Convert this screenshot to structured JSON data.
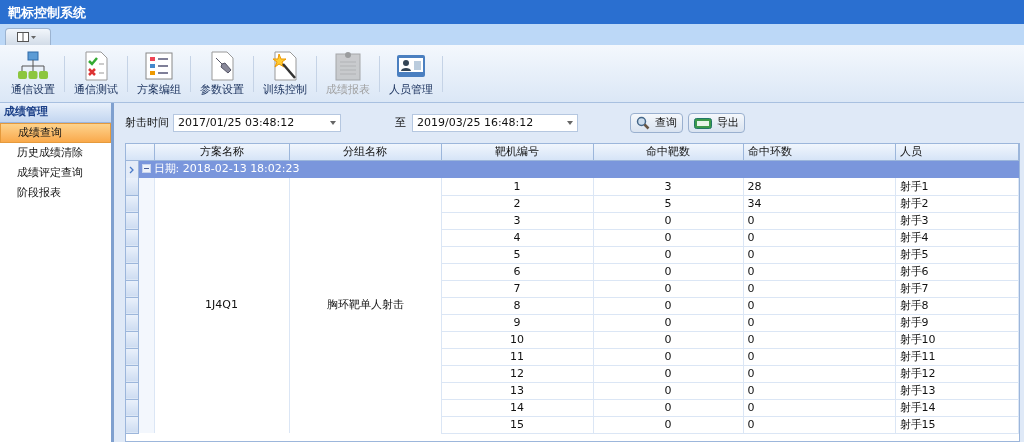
{
  "window": {
    "title": "靶标控制系统"
  },
  "toolbar": [
    {
      "label": "通信设置",
      "disabled": false
    },
    {
      "label": "通信测试",
      "disabled": false
    },
    {
      "label": "方案编组",
      "disabled": false
    },
    {
      "label": "参数设置",
      "disabled": false
    },
    {
      "label": "训练控制",
      "disabled": false
    },
    {
      "label": "成绩报表",
      "disabled": true
    },
    {
      "label": "人员管理",
      "disabled": false
    }
  ],
  "sidebar": {
    "title": "成绩管理",
    "items": [
      {
        "label": "成绩查询",
        "selected": true
      },
      {
        "label": "历史成绩清除",
        "selected": false
      },
      {
        "label": "成绩评定查询",
        "selected": false
      },
      {
        "label": "阶段报表",
        "selected": false
      }
    ]
  },
  "filter": {
    "label": "射击时间",
    "from": "2017/01/25 03:48:12",
    "to_label": "至",
    "to": "2019/03/25 16:48:12",
    "buttons": [
      "查询",
      "导出"
    ]
  },
  "table": {
    "columns": [
      "方案名称",
      "分组名称",
      "靶机编号",
      "命中靶数",
      "命中环数",
      "人员"
    ],
    "group": {
      "label": "日期: 2018-02-13 18:02:23",
      "expanded": true,
      "current": true
    },
    "rows": [
      [
        {
          "text": "1J4Q1",
          "rowspan": 15
        },
        {
          "text": "胸环靶单人射击",
          "rowspan": 15
        },
        "1",
        "3",
        "28",
        "射手1"
      ],
      [
        "2",
        "5",
        "34",
        "射手2"
      ],
      [
        "3",
        "0",
        "0",
        "射手3"
      ],
      [
        "4",
        "0",
        "0",
        "射手4"
      ],
      [
        "5",
        "0",
        "0",
        "射手5"
      ],
      [
        "6",
        "0",
        "0",
        "射手6"
      ],
      [
        "7",
        "0",
        "0",
        "射手7"
      ],
      [
        "8",
        "0",
        "0",
        "射手8"
      ],
      [
        "9",
        "0",
        "0",
        "射手9"
      ],
      [
        "10",
        "0",
        "0",
        "射手10"
      ],
      [
        "11",
        "0",
        "0",
        "射手11"
      ],
      [
        "12",
        "0",
        "0",
        "射手12"
      ],
      [
        "13",
        "0",
        "0",
        "射手13"
      ],
      [
        "14",
        "0",
        "0",
        "射手14"
      ],
      [
        "15",
        "0",
        "0",
        "射手15"
      ]
    ]
  }
}
